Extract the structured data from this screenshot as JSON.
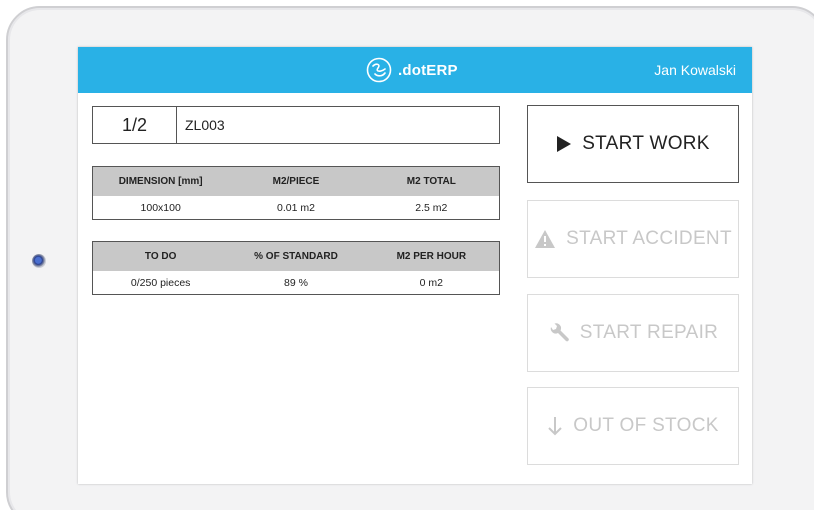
{
  "header": {
    "brand_name": ".dotERP",
    "user_name": "Jan Kowalski",
    "accent_color": "#29b1e6"
  },
  "order": {
    "position": "1/2",
    "code": "ZL003"
  },
  "dimensions_table": {
    "headers": [
      "DIMENSION [mm]",
      "M2/PIECE",
      "M2 TOTAL"
    ],
    "row": [
      "100x100",
      "0.01 m2",
      "2.5 m2"
    ]
  },
  "progress_table": {
    "headers": [
      "TO DO",
      "% OF STANDARD",
      "M2 PER HOUR"
    ],
    "row": [
      "0/250 pieces",
      "89 %",
      "0 m2"
    ]
  },
  "actions": {
    "start_work": {
      "label": "START WORK",
      "icon": "play-icon"
    },
    "start_accident": {
      "label": "START ACCIDENT",
      "icon": "warning-icon"
    },
    "start_repair": {
      "label": "START REPAIR",
      "icon": "wrench-icon"
    },
    "out_of_stock": {
      "label": "OUT OF STOCK",
      "icon": "arrow-down-icon"
    }
  }
}
